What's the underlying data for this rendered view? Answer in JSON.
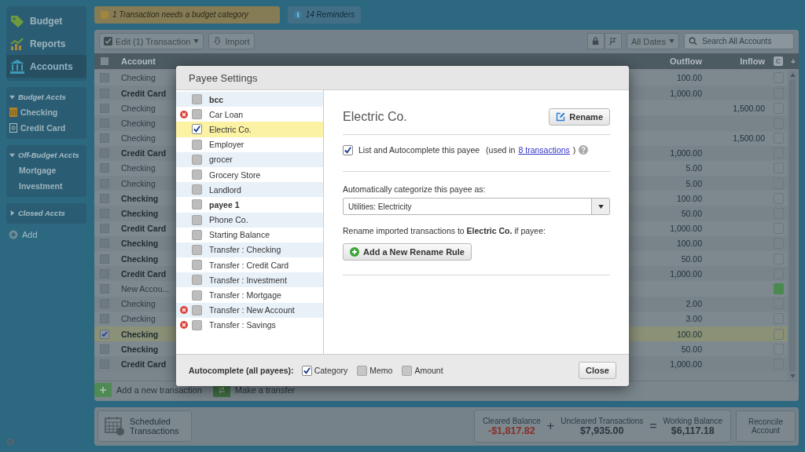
{
  "sidebar": {
    "nav": [
      {
        "label": "Budget",
        "kind": "budget",
        "selected": false
      },
      {
        "label": "Reports",
        "kind": "reports",
        "selected": false
      },
      {
        "label": "Accounts",
        "kind": "accounts",
        "selected": true
      }
    ],
    "sections": [
      {
        "title": "Budget Accts",
        "expanded": true,
        "accounts": [
          {
            "name": "Checking",
            "kind": "checking"
          },
          {
            "name": "Credit Card",
            "kind": "credit"
          }
        ]
      },
      {
        "title": "Off-Budget Accts",
        "expanded": true,
        "accounts": [
          {
            "name": "Mortgage"
          },
          {
            "name": "Investment"
          }
        ]
      },
      {
        "title": "Closed Accts",
        "expanded": false
      }
    ],
    "add_label": "Add"
  },
  "notices": [
    {
      "kind": "warning",
      "text": "1 Transaction needs a budget category"
    },
    {
      "kind": "info",
      "text": "14 Reminders"
    }
  ],
  "toolbar": {
    "edit_button": "Edit (1) Transaction",
    "import_button": "Import",
    "date_filter": "All Dates",
    "search": {
      "placeholder": "Search All Accounts"
    }
  },
  "table": {
    "select_all_checked": false,
    "columns": {
      "account": "Account",
      "outflow": "Outflow",
      "inflow": "Inflow",
      "cleared": "C",
      "add": "+"
    },
    "rows": [
      {
        "account": "Checking",
        "muted": true,
        "selected": false,
        "outflow": "100.00",
        "cleared": false
      },
      {
        "account": "Credit Card",
        "muted": false,
        "selected": false,
        "outflow": "1,000.00",
        "cleared": false
      },
      {
        "account": "Checking",
        "muted": true,
        "selected": false,
        "inflow": "1,500.00",
        "cleared": false
      },
      {
        "account": "Checking",
        "muted": true,
        "selected": false,
        "cleared": false
      },
      {
        "account": "Checking",
        "muted": true,
        "selected": false,
        "inflow": "1,500.00",
        "cleared": false
      },
      {
        "account": "Credit Card",
        "muted": false,
        "selected": false,
        "outflow": "1,000.00",
        "cleared": false
      },
      {
        "account": "Checking",
        "muted": true,
        "selected": false,
        "outflow": "5.00",
        "cleared": false
      },
      {
        "account": "Checking",
        "muted": true,
        "selected": false,
        "outflow": "5.00",
        "cleared": false
      },
      {
        "account": "Checking",
        "muted": false,
        "selected": false,
        "outflow": "100.00",
        "cleared": false
      },
      {
        "account": "Checking",
        "muted": false,
        "selected": false,
        "outflow": "50.00",
        "cleared": false
      },
      {
        "account": "Credit Card",
        "muted": false,
        "selected": false,
        "outflow": "1,000.00",
        "cleared": false
      },
      {
        "account": "Checking",
        "muted": false,
        "selected": false,
        "outflow": "100.00",
        "cleared": false
      },
      {
        "account": "Checking",
        "muted": false,
        "selected": false,
        "outflow": "50.00",
        "cleared": false
      },
      {
        "account": "Credit Card",
        "muted": false,
        "selected": false,
        "outflow": "1,000.00",
        "cleared": false
      },
      {
        "account": "New Accou...",
        "muted": true,
        "selected": false,
        "cleared": true
      },
      {
        "account": "Checking",
        "muted": true,
        "selected": false,
        "outflow": "2.00",
        "cleared": false
      },
      {
        "account": "Checking",
        "muted": true,
        "selected": false,
        "outflow": "3.00",
        "cleared": false
      },
      {
        "account": "Checking",
        "muted": false,
        "selected": true,
        "outflow": "100.00",
        "cleared": false
      },
      {
        "account": "Checking",
        "muted": false,
        "selected": false,
        "outflow": "50.00",
        "cleared": false
      },
      {
        "account": "Credit Card",
        "muted": false,
        "selected": false,
        "outflow": "1,000.00",
        "cleared": false
      }
    ]
  },
  "footer_actions": {
    "add_transaction": "Add a new transaction",
    "transfer": "Make a transfer"
  },
  "summary": {
    "scheduled": "Scheduled Transactions",
    "cleared_label": "Cleared Balance",
    "cleared_value": "-$1,817.82",
    "plus": "+",
    "uncleared_label": "Uncleared Transactions",
    "uncleared_value": "$7,935.00",
    "equals": "=",
    "working_label": "Working Balance",
    "working_value": "$6,117.18",
    "reconcile": "Reconcile Account"
  },
  "dialog": {
    "title": "Payee Settings",
    "payees": [
      {
        "name": "bcc",
        "bold": true,
        "blocked": false,
        "checked": false,
        "selected": false
      },
      {
        "name": "Car Loan",
        "bold": false,
        "blocked": true,
        "checked": false,
        "selected": false
      },
      {
        "name": "Electric Co.",
        "bold": false,
        "blocked": false,
        "checked": true,
        "selected": true
      },
      {
        "name": "Employer",
        "bold": false,
        "blocked": false,
        "checked": false,
        "selected": false
      },
      {
        "name": "grocer",
        "bold": false,
        "blocked": false,
        "checked": false,
        "selected": false
      },
      {
        "name": "Grocery Store",
        "bold": false,
        "blocked": false,
        "checked": false,
        "selected": false
      },
      {
        "name": "Landlord",
        "bold": false,
        "blocked": false,
        "checked": false,
        "selected": false
      },
      {
        "name": "payee 1",
        "bold": true,
        "blocked": false,
        "checked": false,
        "selected": false
      },
      {
        "name": "Phone Co.",
        "bold": false,
        "blocked": false,
        "checked": false,
        "selected": false
      },
      {
        "name": "Starting Balance",
        "bold": false,
        "blocked": false,
        "checked": false,
        "selected": false
      },
      {
        "name": "Transfer : Checking",
        "bold": false,
        "blocked": false,
        "checked": false,
        "selected": false
      },
      {
        "name": "Transfer : Credit Card",
        "bold": false,
        "blocked": false,
        "checked": false,
        "selected": false
      },
      {
        "name": "Transfer : Investment",
        "bold": false,
        "blocked": false,
        "checked": false,
        "selected": false
      },
      {
        "name": "Transfer : Mortgage",
        "bold": false,
        "blocked": false,
        "checked": false,
        "selected": false
      },
      {
        "name": "Transfer : New Account",
        "bold": false,
        "blocked": true,
        "checked": false,
        "selected": false
      },
      {
        "name": "Transfer : Savings",
        "bold": false,
        "blocked": true,
        "checked": false,
        "selected": false
      }
    ],
    "detail": {
      "name": "Electric Co.",
      "rename_button": "Rename",
      "list_checkbox": {
        "label": "List and Autocomplete this payee",
        "checked": true
      },
      "used_in_prefix": "(used in",
      "used_in_link": "8 transactions",
      "used_in_suffix": ")",
      "category_label": "Automatically categorize this payee as:",
      "category_value": "Utilities: Electricity",
      "rename_rule_text": "Rename imported transactions to **Electric Co.** if payee:",
      "add_rule_button": "Add a New Rename Rule"
    },
    "autocomplete_label": "Autocomplete (all payees):",
    "autocomplete_options": [
      {
        "label": "Category",
        "checked": true
      },
      {
        "label": "Memo",
        "checked": false
      },
      {
        "label": "Amount",
        "checked": false
      }
    ],
    "close_button": "Close"
  }
}
